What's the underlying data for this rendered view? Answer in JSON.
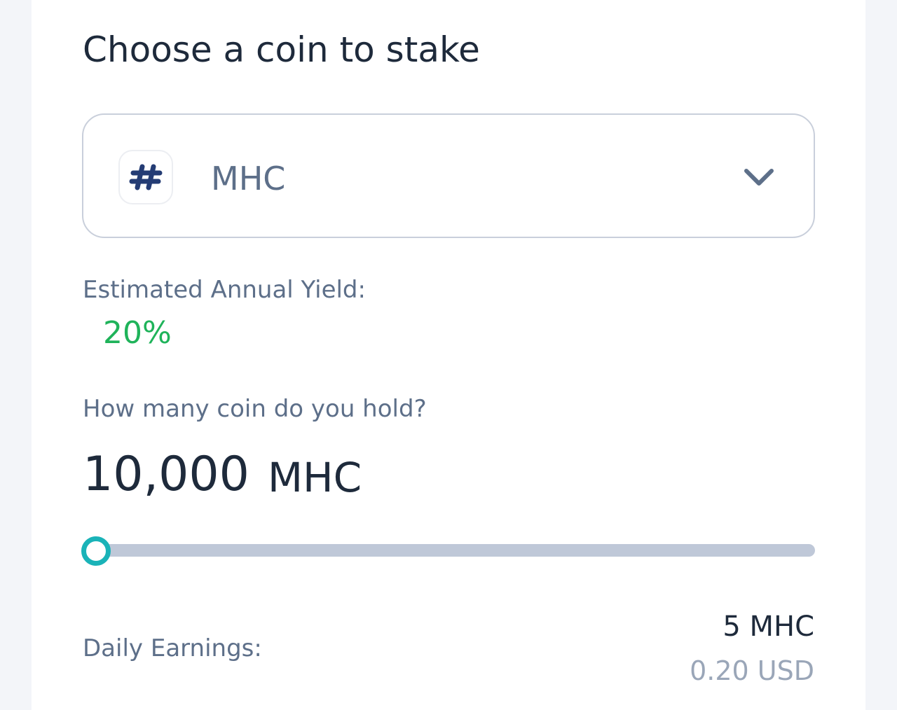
{
  "page": {
    "title": "Choose a coin to stake"
  },
  "coin_select": {
    "selected": "MHC",
    "coin_icon": "hashtag-icon",
    "dropdown_icon": "chevron-down-icon"
  },
  "yield": {
    "label": "Estimated Annual Yield:",
    "value": "20%",
    "value_color": "#1fb35a"
  },
  "holding": {
    "label": "How many coin do you hold?",
    "amount": "10,000",
    "unit": "MHC",
    "slider_fraction": 0,
    "slider_color": "#1ab3b8"
  },
  "earnings": {
    "label": "Daily Earnings:",
    "coin_value": "5 MHC",
    "usd_value": "0.20 USD"
  }
}
